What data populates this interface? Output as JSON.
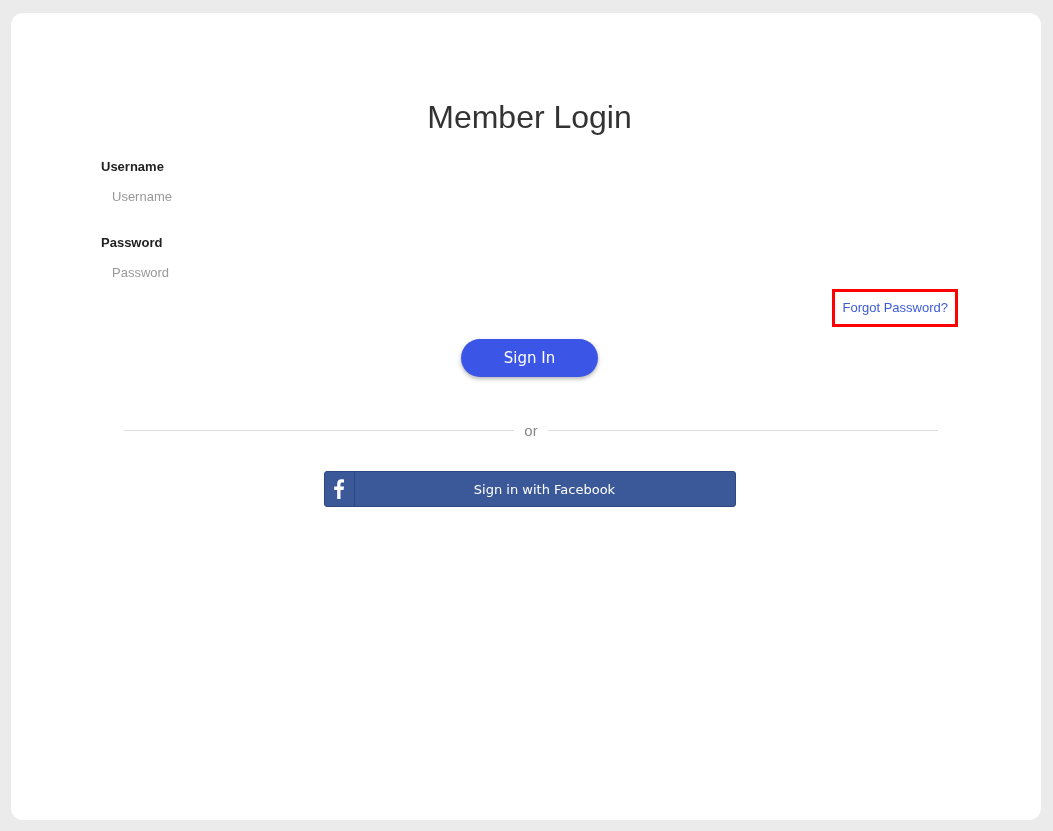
{
  "title": "Member Login",
  "fields": [
    {
      "label": "Username",
      "placeholder": "Username"
    },
    {
      "label": "Password",
      "placeholder": "Password"
    }
  ],
  "forgot_link": {
    "label": "Forgot Password?",
    "highlighted": true
  },
  "sign_in_button": "Sign In",
  "divider_text": "or",
  "facebook_button": "Sign in with Facebook"
}
